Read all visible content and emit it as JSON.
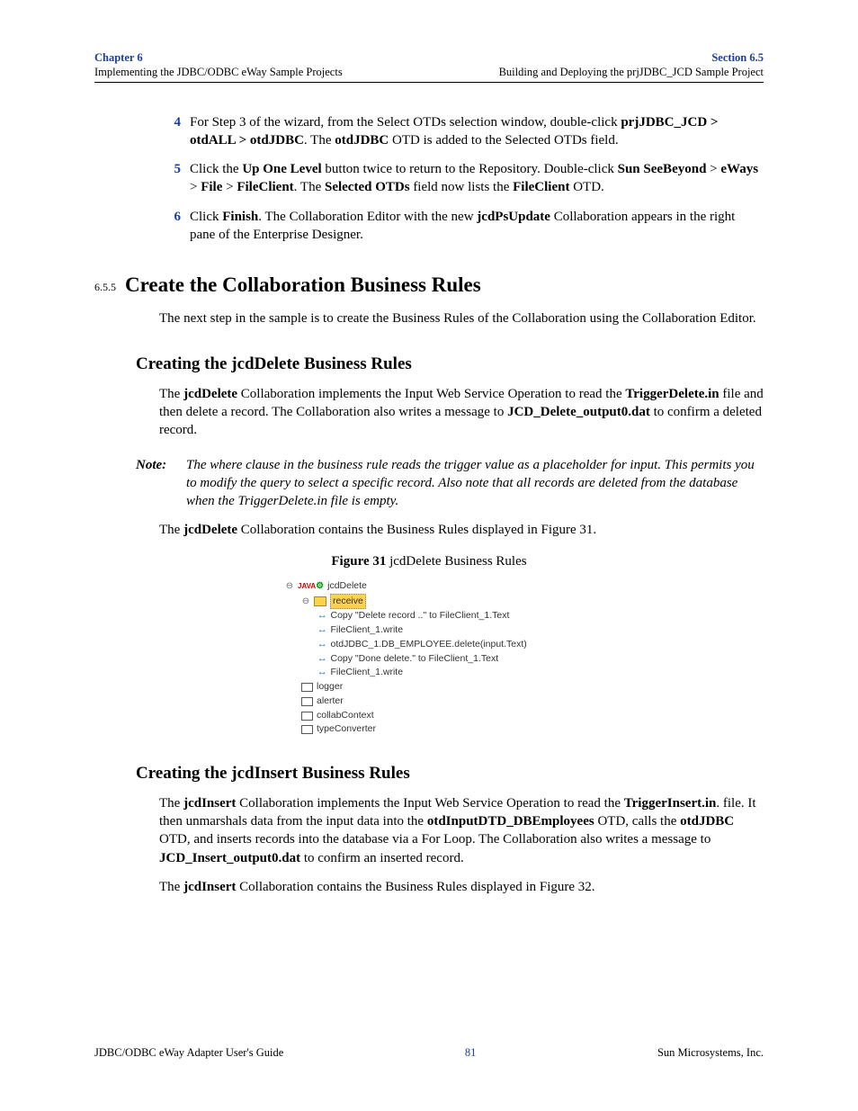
{
  "header": {
    "chapter": "Chapter 6",
    "chapter_sub": "Implementing the JDBC/ODBC eWay Sample Projects",
    "section": "Section 6.5",
    "section_sub": "Building and Deploying the prjJDBC_JCD Sample Project"
  },
  "steps": {
    "s4_num": "4",
    "s4_a": "For Step 3 of the wizard, from the Select OTDs selection window, double-click ",
    "s4_b": "prjJDBC_JCD > otdALL > otdJDBC",
    "s4_c": ". The ",
    "s4_d": "otdJDBC",
    "s4_e": " OTD is added to the Selected OTDs field.",
    "s5_num": "5",
    "s5_a": "Click the ",
    "s5_b": "Up One Level",
    "s5_c": " button twice to return to the Repository. Double-click ",
    "s5_d": "Sun SeeBeyond",
    "s5_e": " > ",
    "s5_f": "eWays",
    "s5_g": " > ",
    "s5_h": "File",
    "s5_i": " > ",
    "s5_j": "FileClient",
    "s5_k": ". The ",
    "s5_l": "Selected OTDs",
    "s5_m": " field now lists the ",
    "s5_n": "FileClient",
    "s5_o": " OTD.",
    "s6_num": "6",
    "s6_a": "Click ",
    "s6_b": "Finish",
    "s6_c": ". The Collaboration Editor with the new ",
    "s6_d": "jcdPsUpdate",
    "s6_e": " Collaboration appears in the right pane of the Enterprise Designer."
  },
  "sec655": {
    "num": "6.5.5",
    "title": "Create the Collaboration Business Rules",
    "intro": "The next step in the sample is to create the Business Rules of the Collaboration using the Collaboration Editor."
  },
  "delete": {
    "heading": "Creating the jcdDelete Business Rules",
    "p1_a": "The ",
    "p1_b": "jcdDelete",
    "p1_c": " Collaboration implements the Input Web Service Operation to read the ",
    "p1_d": "TriggerDelete.in",
    "p1_e": " file and then delete a record. The Collaboration also writes a message to ",
    "p1_f": "JCD_Delete_output0.dat",
    "p1_g": " to confirm a deleted record.",
    "note_label": "Note:",
    "note": "The where clause in the business rule reads the trigger value as a placeholder for input. This permits you to modify the query to select a specific record. Also note that all records are deleted from the database when the TriggerDelete.in file is empty.",
    "p2_a": "The ",
    "p2_b": "jcdDelete",
    "p2_c": " Collaboration contains the Business Rules displayed in Figure 31.",
    "fig_label": "Figure 31",
    "fig_title": "   jcdDelete Business Rules"
  },
  "tree": {
    "root": "jcdDelete",
    "receive": "receive",
    "r1": "Copy \"Delete record ..\" to FileClient_1.Text",
    "r2": "FileClient_1.write",
    "r3": "otdJDBC_1.DB_EMPLOYEE.delete(input.Text)",
    "r4": "Copy \"Done delete.\" to FileClient_1.Text",
    "r5": "FileClient_1.write",
    "n1": "logger",
    "n2": "alerter",
    "n3": "collabContext",
    "n4": "typeConverter"
  },
  "insert": {
    "heading": "Creating the jcdInsert Business Rules",
    "p1_a": "The ",
    "p1_b": "jcdInsert",
    "p1_c": " Collaboration implements the Input Web Service Operation to read the ",
    "p1_d": "TriggerInsert.in",
    "p1_e": ". file. It then unmarshals data from the input data into the ",
    "p1_f": "otdInputDTD_DBEmployees",
    "p1_g": " OTD, calls the ",
    "p1_h": "otdJDBC",
    "p1_i": " OTD, and inserts records into the database via a For Loop. The Collaboration also writes a message to ",
    "p1_j": "JCD_Insert_output0.dat",
    "p1_k": " to confirm an inserted record.",
    "p2_a": "The ",
    "p2_b": "jcdInsert",
    "p2_c": " Collaboration contains the Business Rules displayed in Figure 32."
  },
  "footer": {
    "left": "JDBC/ODBC eWay Adapter User's Guide",
    "page": "81",
    "right": "Sun Microsystems, Inc."
  }
}
